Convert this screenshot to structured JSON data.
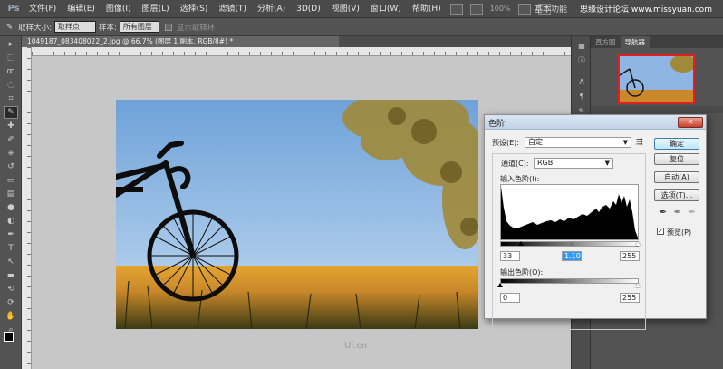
{
  "app": {
    "logo": "Ps",
    "workspace": "基本功能",
    "watermark": "思缘设计论坛 www.missyuan.com",
    "zoom": "100%"
  },
  "menu": [
    "文件(F)",
    "编辑(E)",
    "图像(I)",
    "图层(L)",
    "选择(S)",
    "滤镜(T)",
    "分析(A)",
    "3D(D)",
    "视图(V)",
    "窗口(W)",
    "帮助(H)"
  ],
  "options": {
    "sample_size_label": "取样大小:",
    "sample_size_value": "取样点",
    "sample_label": "样本:",
    "sample_value": "所有图层",
    "ring_label": "显示取样环"
  },
  "document": {
    "tab": "1049187_083408022_2.jpg @ 66.7% (图层 1 副本, RGB/8#) *"
  },
  "panels": {
    "tab_histogram": "直方图",
    "tab_navigator": "导航器"
  },
  "dialog": {
    "title": "色阶",
    "preset_label": "预设(E):",
    "preset_value": "自定",
    "channel_label": "通道(C):",
    "channel_value": "RGB",
    "input_label": "输入色阶(I):",
    "input_black": "33",
    "input_gamma": "1.10",
    "input_white": "255",
    "output_label": "输出色阶(O):",
    "output_black": "0",
    "output_white": "255",
    "btn_ok": "确定",
    "btn_reset": "复位",
    "btn_auto": "自动(A)",
    "btn_options": "选项(T)...",
    "preview_label": "预览(P)",
    "close_glyph": "✕"
  },
  "canvas_logo": "Ui.cn",
  "colors": {
    "accent": "#3399ff",
    "nav_frame": "#e02020"
  }
}
